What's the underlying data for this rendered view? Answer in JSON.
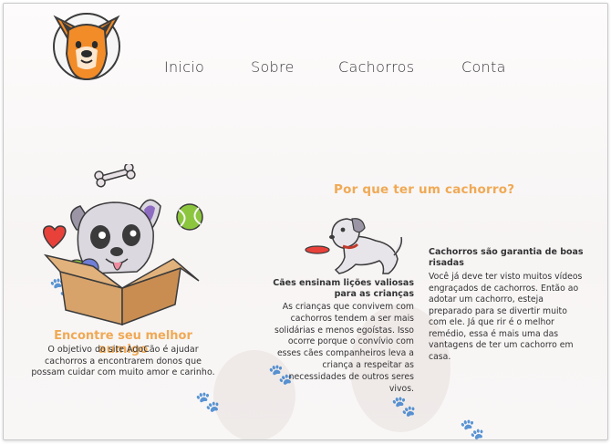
{
  "nav": {
    "items": [
      "Inicio",
      "Sobre",
      "Cachorros",
      "Conta"
    ]
  },
  "why": {
    "title": "Por que ter um cachorro?"
  },
  "find": {
    "title": "Encontre seu melhor aumigo",
    "text": "O objetivo do site AdoCão é ajudar cachorros a encontrarem donos que possam cuidar com muito amor e carinho."
  },
  "lessons": {
    "title": "Cães ensinam lições valiosas para as crianças",
    "text": "As crianças que convivem com cachorros tendem a ser mais solidárias e menos egoístas. Isso ocorre porque o convívio com esses cães companheiros leva a criança a respeitar as necessidades de outros seres vivos."
  },
  "laughs": {
    "title": "Cachorros são garantia de boas risadas",
    "text": "Você já deve ter visto muitos vídeos engraçados de cachorros. Então ao adotar um cachorro, esteja preparado para se divertir muito com ele. Já que rir é o melhor remédio, essa é mais uma das vantagens de ter um cachorro em casa."
  },
  "colors": {
    "accent": "#f0a955",
    "logo_orange": "#f28c28"
  },
  "icons": [
    "dog-logo-icon",
    "bone-icon",
    "heart-icon",
    "tennis-ball-icon",
    "dog-in-box-icon",
    "running-dog-icon",
    "frisbee-icon",
    "paw-icon"
  ]
}
